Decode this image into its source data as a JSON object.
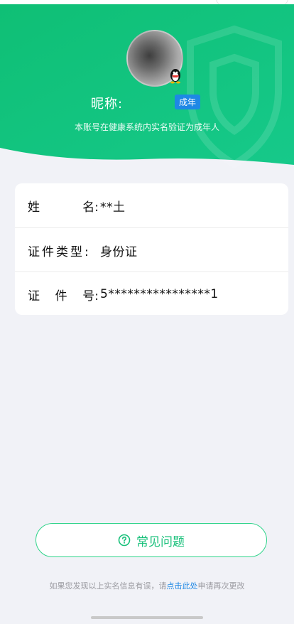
{
  "header": {
    "nickname_label": "昵称:",
    "adult_badge": "成年",
    "verify_note": "本账号在健康系统内实名验证为成年人",
    "brand_color": "#13c37a"
  },
  "info": {
    "rows": [
      {
        "label_chars": [
          "姓",
          "名:"
        ],
        "value": "**土"
      },
      {
        "label_chars": [
          "证件类型:"
        ],
        "value": "身份证"
      },
      {
        "label_chars": [
          "证",
          "件",
          "号:"
        ],
        "value": "5****************1"
      }
    ]
  },
  "faq": {
    "label": "常见问题",
    "icon": "question-circle-icon"
  },
  "footer": {
    "text_before": "如果您发现以上实名信息有误，请",
    "link_text": "点击此处",
    "text_after": "申请再次更改"
  }
}
